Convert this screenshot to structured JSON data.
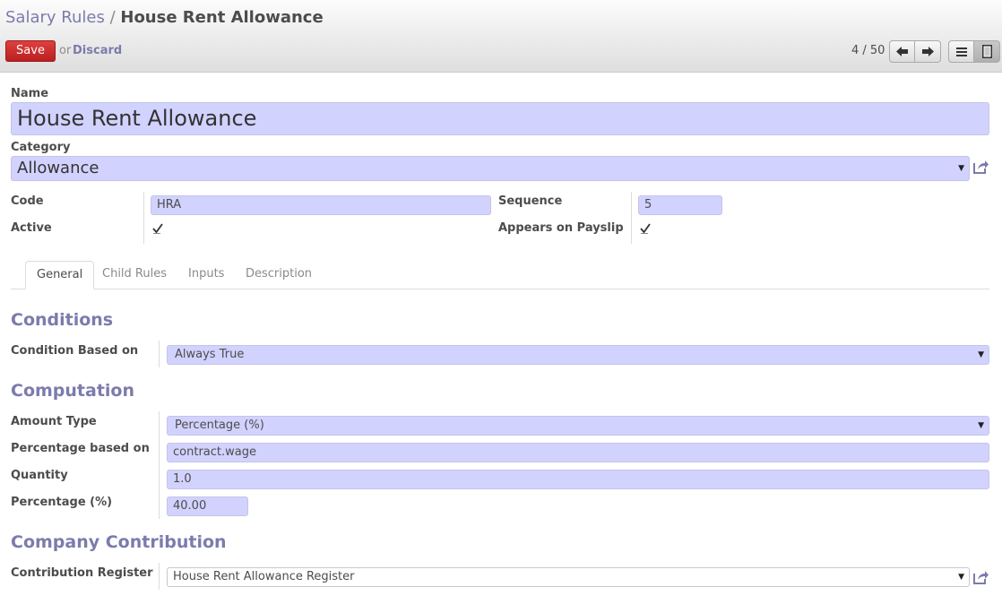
{
  "breadcrumb": {
    "parent": "Salary Rules",
    "separator": "/",
    "current": "House Rent Allowance"
  },
  "toolbar": {
    "save_label": "Save",
    "or_text": "or",
    "discard_label": "Discard",
    "pager": "4 / 50"
  },
  "form": {
    "name_label": "Name",
    "name_value": "House Rent Allowance",
    "category_label": "Category",
    "category_value": "Allowance",
    "code_label": "Code",
    "code_value": "HRA",
    "sequence_label": "Sequence",
    "sequence_value": "5",
    "active_label": "Active",
    "active_checked": true,
    "payslip_label": "Appears on Payslip",
    "payslip_checked": true
  },
  "tabs": [
    {
      "label": "General",
      "active": true
    },
    {
      "label": "Child Rules",
      "active": false
    },
    {
      "label": "Inputs",
      "active": false
    },
    {
      "label": "Description",
      "active": false
    }
  ],
  "conditions": {
    "title": "Conditions",
    "condition_label": "Condition Based on",
    "condition_value": "Always True"
  },
  "computation": {
    "title": "Computation",
    "amount_type_label": "Amount Type",
    "amount_type_value": "Percentage (%)",
    "pct_base_label": "Percentage based on",
    "pct_base_value": "contract.wage",
    "quantity_label": "Quantity",
    "quantity_value": "1.0",
    "percentage_label": "Percentage (%)",
    "percentage_value": "40.00"
  },
  "company": {
    "title": "Company Contribution",
    "register_label": "Contribution Register",
    "register_value": "House Rent Allowance Register"
  },
  "colors": {
    "accent": "#7c7bad",
    "field_bg": "#d2d2ff",
    "save_red": "#c9302c"
  },
  "icons": {
    "prev": "arrow-left-icon",
    "next": "arrow-right-icon",
    "list": "list-view-icon",
    "form": "form-view-icon",
    "external": "external-link-icon",
    "check": "checkmark-icon"
  }
}
